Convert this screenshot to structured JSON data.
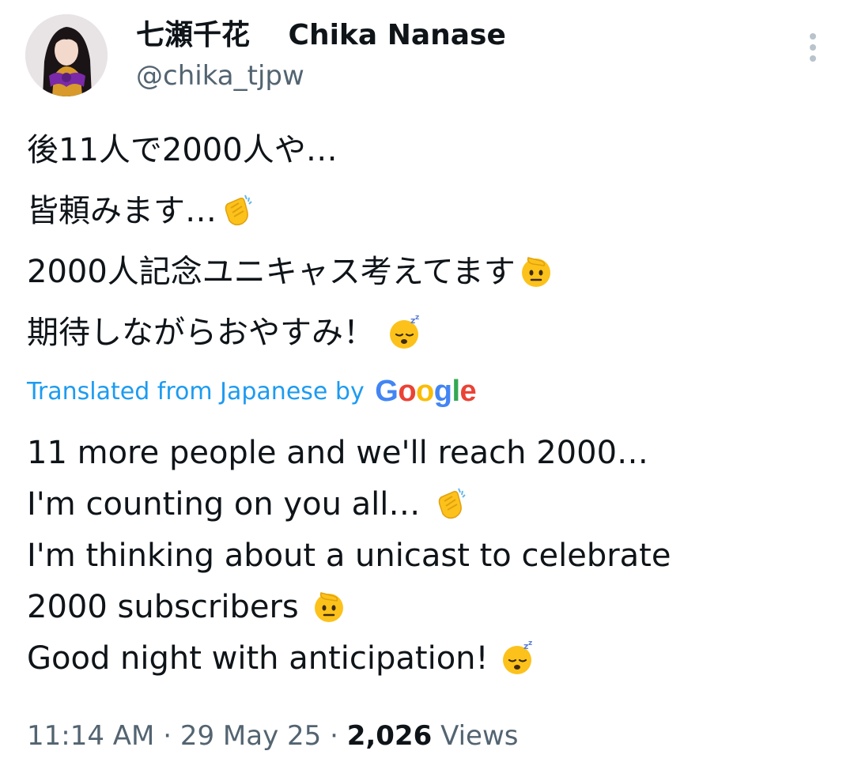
{
  "author": {
    "display_name": "七瀬千花　 Chika Nanase",
    "handle": "@chika_tjpw"
  },
  "tweet": {
    "original_lines": [
      {
        "text": "後11人で2000人や…",
        "emoji": ""
      },
      {
        "text": "皆頼みます…",
        "emoji": "clapping-hands"
      },
      {
        "text": "2000人記念ユニキャス考えてます",
        "emoji": "saluting-face"
      },
      {
        "text": "期待しながらおやすみ！ ",
        "emoji": "sleeping-face"
      }
    ],
    "translated_from": "Translated from Japanese by",
    "translator": "Google",
    "translation_lines": [
      {
        "text": "11 more people and we'll reach 2000…",
        "emoji": ""
      },
      {
        "text": "I'm counting on you all… ",
        "emoji": "clapping-hands"
      },
      {
        "text": "I'm thinking about a unicast to celebrate",
        "emoji": ""
      },
      {
        "text": "2000 subscribers ",
        "emoji": "saluting-face"
      },
      {
        "text": "Good night with anticipation! ",
        "emoji": "sleeping-face"
      }
    ]
  },
  "meta": {
    "time": "11:14 AM",
    "separator": "·",
    "date": "29 May 25",
    "views_count": "2,026",
    "views_label": "Views"
  },
  "colors": {
    "text_primary": "#0f1419",
    "text_secondary": "#536471",
    "link_blue": "#1d9bf0",
    "google_blue": "#4285f4",
    "google_red": "#ea4335",
    "google_yellow": "#fbbc05",
    "google_green": "#34a853"
  }
}
